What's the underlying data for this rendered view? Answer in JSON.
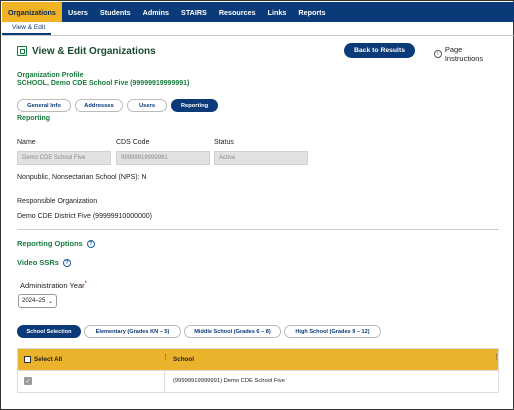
{
  "nav": {
    "items": [
      {
        "label": "Organizations",
        "active": true
      },
      {
        "label": "Users",
        "active": false
      },
      {
        "label": "Students",
        "active": false
      },
      {
        "label": "Admins",
        "active": false
      },
      {
        "label": "STAIRS",
        "active": false
      },
      {
        "label": "Resources",
        "active": false
      },
      {
        "label": "Links",
        "active": false
      },
      {
        "label": "Reports",
        "active": false
      }
    ]
  },
  "subnav": {
    "active_tab": "View & Edit"
  },
  "header": {
    "title": "View & Edit Organizations",
    "back_button": "Back to Results",
    "instructions": "Page Instructions",
    "info_glyph": "i"
  },
  "profile": {
    "label": "Organization Profile",
    "name": "SCHOOL, Demo CDE School Five (99999919999991)"
  },
  "tabs": [
    {
      "label": "General Info",
      "active": false
    },
    {
      "label": "Addresses",
      "active": false
    },
    {
      "label": "Users",
      "active": false
    },
    {
      "label": "Reporting",
      "active": true
    }
  ],
  "reporting": {
    "heading": "Reporting",
    "name_label": "Name",
    "name_value": "Demo CDE School Five",
    "cds_label": "CDS Code",
    "cds_value": "99999919999991",
    "status_label": "Status",
    "status_value": "Active",
    "nps_line": "Nonpublic, Nonsectarian School (NPS): N",
    "responsible_label": "Responsible Organization",
    "responsible_value": "Demo CDE District Five (99999910000000)"
  },
  "options": {
    "heading": "Reporting Options",
    "video_heading": "Video SSRs",
    "help_glyph": "?",
    "admin_year_label": "Administration Year",
    "required_mark": "*",
    "admin_year_value": "2024–25",
    "chevron_glyph": "⌄"
  },
  "grade_tabs": [
    {
      "label": "School Selection",
      "active": true
    },
    {
      "label": "Elementary (Grades KN – 5)",
      "active": false
    },
    {
      "label": "Middle School (Grades 6 – 8)",
      "active": false
    },
    {
      "label": "High School (Grades 9 – 12)",
      "active": false
    }
  ],
  "table": {
    "col_select_all": "Select All",
    "col_school": "School",
    "check_glyph": "✓",
    "rows": [
      {
        "school": "(99999919999991) Demo CDE School Five",
        "checked": true
      }
    ]
  },
  "colors": {
    "nav_bg": "#0b3a78",
    "nav_active": "#f0b323",
    "heading_green": "#1a7a3e",
    "table_header": "#ebb22b"
  }
}
